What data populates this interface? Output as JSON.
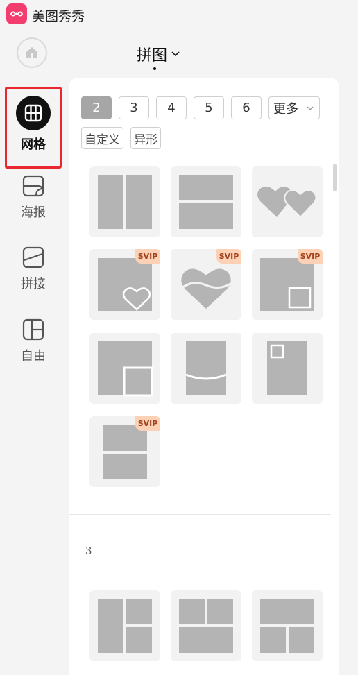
{
  "app": {
    "name": "美图秀秀",
    "logo": "meitu-logo"
  },
  "colors": {
    "accent": "#f23d6e",
    "highlight": "#e8282e",
    "svip_bg": "#fdd1b5",
    "svip_text": "#a1421e",
    "shape_fill": "#b4b4b4"
  },
  "header": {
    "title": "拼图"
  },
  "sidebar": {
    "home_icon": "home-icon",
    "items": [
      {
        "label": "网格",
        "icon": "grid-icon",
        "active": true
      },
      {
        "label": "海报",
        "icon": "poster-icon",
        "active": false
      },
      {
        "label": "拼接",
        "icon": "stitch-icon",
        "active": false
      },
      {
        "label": "自由",
        "icon": "freeform-icon",
        "active": false
      }
    ]
  },
  "count_tabs": {
    "items": [
      "2",
      "3",
      "4",
      "5",
      "6"
    ],
    "selected": "2",
    "more_label": "更多"
  },
  "shape_tabs": {
    "items": [
      "自定义",
      "异形"
    ]
  },
  "templates": {
    "badge_label": "SVIP",
    "section_2": [
      {
        "layout": "two-columns",
        "svip": false
      },
      {
        "layout": "two-rows",
        "svip": false
      },
      {
        "layout": "two-hearts",
        "svip": false
      },
      {
        "layout": "heart-inset",
        "svip": true
      },
      {
        "layout": "heart-wave",
        "svip": true
      },
      {
        "layout": "square-inset",
        "svip": true
      },
      {
        "layout": "corner-inset",
        "svip": false
      },
      {
        "layout": "curved-split",
        "svip": false
      },
      {
        "layout": "small-inset",
        "svip": false
      },
      {
        "layout": "stacked-rows",
        "svip": true
      }
    ],
    "section_3_label": "3",
    "section_3": [
      {
        "layout": "left-big-right-two",
        "svip": false
      },
      {
        "layout": "top-two-bottom-one",
        "svip": false
      },
      {
        "layout": "top-one-bottom-two",
        "svip": false
      }
    ]
  }
}
